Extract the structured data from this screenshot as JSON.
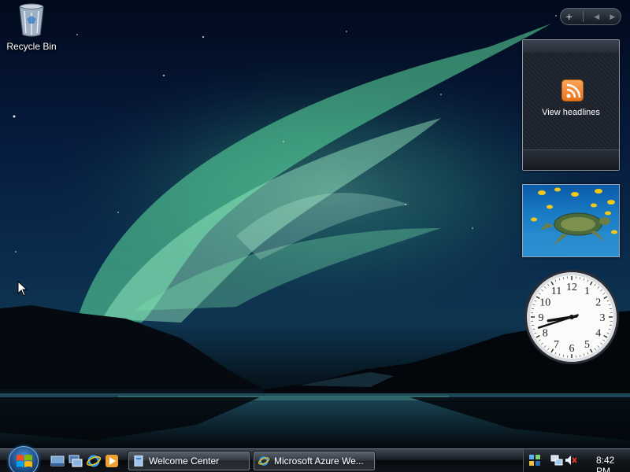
{
  "desktop": {
    "icons": [
      {
        "label": "Recycle Bin",
        "icon": "recycle-bin-icon"
      }
    ]
  },
  "sidebar": {
    "add_gadget": "+",
    "prev": "◀",
    "next": "▶"
  },
  "feed_gadget": {
    "link_text": "View headlines",
    "icon": "rss-feed-icon"
  },
  "slideshow_gadget": {
    "icon": "slideshow-photo"
  },
  "clock_gadget": {
    "numbers": [
      "12",
      "1",
      "2",
      "3",
      "4",
      "5",
      "6",
      "7",
      "8",
      "9",
      "10",
      "11"
    ],
    "time": "8:42"
  },
  "taskbar": {
    "start": "start-orb-icon",
    "quick_launch": [
      "show-desktop-icon",
      "switch-windows-icon",
      "internet-explorer-icon",
      "media-player-icon"
    ],
    "buttons": [
      {
        "label": "Welcome Center",
        "icon": "welcome-center-icon"
      },
      {
        "label": "Microsoft Azure We...",
        "icon": "internet-explorer-icon"
      }
    ],
    "tray": {
      "icons": [
        "app-tray-icon",
        "network-icon",
        "volume-muted-icon"
      ],
      "clock": "8:42 PM"
    }
  },
  "colors": {
    "aurora": "#4fdf9a",
    "taskbar": "#1a1f26",
    "accent": "#1c4f8c"
  }
}
